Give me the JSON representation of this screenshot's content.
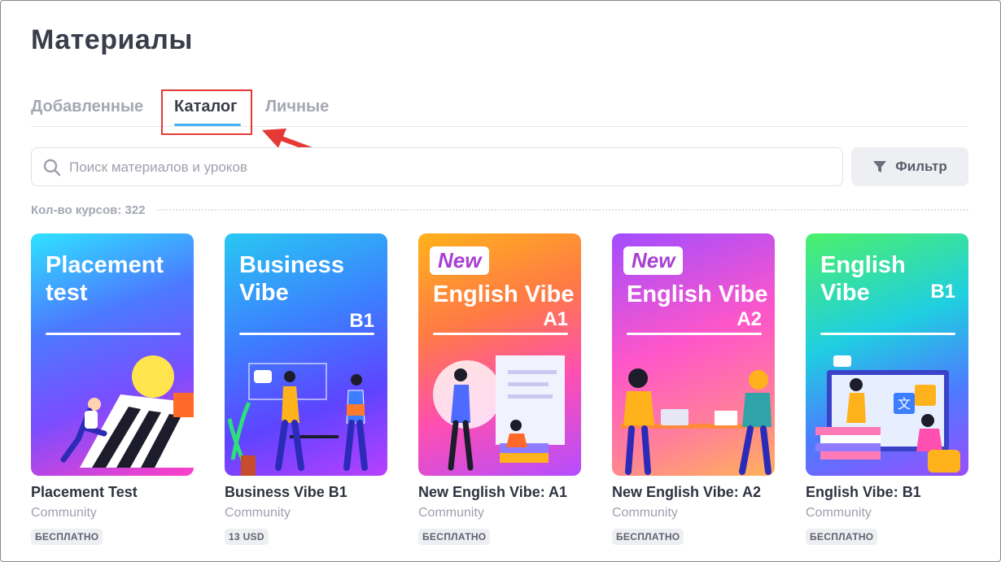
{
  "page": {
    "title": "Материалы"
  },
  "tabs": [
    {
      "label": "Добавленные",
      "active": false
    },
    {
      "label": "Каталог",
      "active": true
    },
    {
      "label": "Личные",
      "active": false
    }
  ],
  "search": {
    "placeholder": "Поиск материалов и уроков",
    "value": ""
  },
  "filter": {
    "label": "Фильтр",
    "icon": "funnel-icon"
  },
  "count": {
    "label": "Кол-во курсов: 322"
  },
  "colors": {
    "accent": "#43b2f0",
    "highlight": "#e53935",
    "text": "#2f3341",
    "muted": "#9da1ac"
  },
  "courses": [
    {
      "cover_title": "Placement\ntest",
      "cover_level": "",
      "badge": "",
      "name": "Placement Test",
      "author": "Community",
      "price": "БЕСПЛАТНО"
    },
    {
      "cover_title": "Business\nVibe",
      "cover_level": "B1",
      "badge": "",
      "name": "Business Vibe B1",
      "author": "Community",
      "price": "13 USD"
    },
    {
      "cover_title": "English Vibe",
      "cover_level": "A1",
      "badge": "New",
      "name": "New English Vibe: A1",
      "author": "Community",
      "price": "БЕСПЛАТНО"
    },
    {
      "cover_title": "English Vibe",
      "cover_level": "A2",
      "badge": "New",
      "name": "New English Vibe: A2",
      "author": "Community",
      "price": "БЕСПЛАТНО"
    },
    {
      "cover_title": "English\nVibe",
      "cover_level": "B1",
      "badge": "",
      "name": "English Vibe: B1",
      "author": "Community",
      "price": "БЕСПЛАТНО"
    }
  ]
}
